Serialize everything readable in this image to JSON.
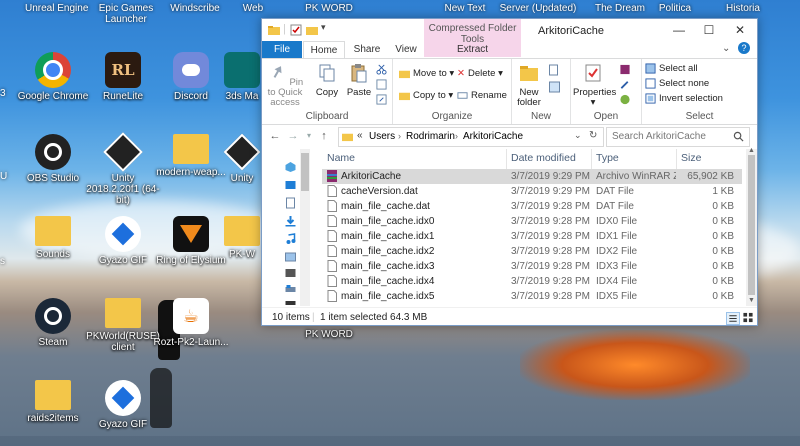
{
  "desktop": {
    "top_labels": [
      "Unreal Engine",
      "Epic Games Launcher",
      "Windscribe",
      "Web",
      "PK WORD",
      "New Text",
      "Server (Updated)",
      "The Dream",
      "Politica",
      "Historia"
    ],
    "icons": [
      {
        "label": "Google Chrome",
        "icon": "chrome-icon"
      },
      {
        "label": "RuneLite",
        "icon": "runelite-icon",
        "glyph": "RL"
      },
      {
        "label": "Discord",
        "icon": "discord-icon"
      },
      {
        "label": "3ds Ma",
        "icon": "3dsmax-icon"
      },
      {
        "label": "OBS Studio",
        "icon": "obs-icon"
      },
      {
        "label": "Unity 2018.2.20f1 (64-bit)",
        "icon": "unity-icon"
      },
      {
        "label": "modern-weap...",
        "icon": "folder-icon"
      },
      {
        "label": "Unity",
        "icon": "unity-icon"
      },
      {
        "label": "Sounds",
        "icon": "folder-icon"
      },
      {
        "label": "Gyazo GIF",
        "icon": "gyazo-icon"
      },
      {
        "label": "Ring of Elysium",
        "icon": "roe-icon"
      },
      {
        "label": "PK-W",
        "icon": "folder-icon"
      },
      {
        "label": "Steam",
        "icon": "steam-icon"
      },
      {
        "label": "PKWorld(RUSE) client",
        "icon": "folder-icon"
      },
      {
        "label": "Rozt-Pk2-Laun...",
        "icon": "java-icon"
      },
      {
        "label": "PK WORD",
        "icon": "text-icon"
      },
      {
        "label": "raids2items",
        "icon": "folder-icon"
      },
      {
        "label": "Gyazo GIF",
        "icon": "gyazo-icon"
      }
    ],
    "edge_labels": [
      "3",
      "U",
      "s"
    ]
  },
  "window": {
    "title": "ArkitoriCache",
    "context_tab_group": "Compressed Folder Tools",
    "controls": {
      "minimize": "—",
      "maximize": "☐",
      "close": "✕"
    },
    "tabs": [
      "File",
      "Home",
      "Share",
      "View",
      "Extract"
    ],
    "ribbon": {
      "clipboard": {
        "label": "Clipboard",
        "pin": "Pin to Quick access",
        "copy": "Copy",
        "paste": "Paste"
      },
      "organize": {
        "label": "Organize",
        "move_to": "Move to",
        "copy_to": "Copy to",
        "delete": "Delete",
        "rename": "Rename"
      },
      "new": {
        "label": "New",
        "new_folder": "New folder"
      },
      "open": {
        "label": "Open",
        "properties": "Properties"
      },
      "select": {
        "label": "Select",
        "select_all": "Select all",
        "select_none": "Select none",
        "invert": "Invert selection"
      }
    },
    "address": {
      "path": [
        "«",
        "Users",
        "Rodrimarin",
        "ArkitoriCache"
      ],
      "search_placeholder": "Search ArkitoriCache"
    },
    "columns": {
      "name": "Name",
      "date": "Date modified",
      "type": "Type",
      "size": "Size"
    },
    "files": [
      {
        "name": "ArkitoriCache",
        "date": "3/7/2019 9:29 PM",
        "type": "Archivo WinRAR Z...",
        "size": "65,902 KB",
        "selected": true,
        "icon": "winrar-icon"
      },
      {
        "name": "cacheVersion.dat",
        "date": "3/7/2019 9:29 PM",
        "type": "DAT File",
        "size": "1 KB",
        "selected": false,
        "icon": "file-icon"
      },
      {
        "name": "main_file_cache.dat",
        "date": "3/7/2019 9:28 PM",
        "type": "DAT File",
        "size": "0 KB",
        "selected": false,
        "icon": "file-icon"
      },
      {
        "name": "main_file_cache.idx0",
        "date": "3/7/2019 9:28 PM",
        "type": "IDX0 File",
        "size": "0 KB",
        "selected": false,
        "icon": "file-icon"
      },
      {
        "name": "main_file_cache.idx1",
        "date": "3/7/2019 9:28 PM",
        "type": "IDX1 File",
        "size": "0 KB",
        "selected": false,
        "icon": "file-icon"
      },
      {
        "name": "main_file_cache.idx2",
        "date": "3/7/2019 9:28 PM",
        "type": "IDX2 File",
        "size": "0 KB",
        "selected": false,
        "icon": "file-icon"
      },
      {
        "name": "main_file_cache.idx3",
        "date": "3/7/2019 9:28 PM",
        "type": "IDX3 File",
        "size": "0 KB",
        "selected": false,
        "icon": "file-icon"
      },
      {
        "name": "main_file_cache.idx4",
        "date": "3/7/2019 9:28 PM",
        "type": "IDX4 File",
        "size": "0 KB",
        "selected": false,
        "icon": "file-icon"
      },
      {
        "name": "main_file_cache.idx5",
        "date": "3/7/2019 9:28 PM",
        "type": "IDX5 File",
        "size": "0 KB",
        "selected": false,
        "icon": "file-icon"
      }
    ],
    "status": {
      "items": "10 items",
      "selected": "1 item selected  64.3 MB"
    }
  },
  "colors": {
    "accent": "#1979ca",
    "selected_row": "#d9d9d9",
    "context_tab": "#f6d5ea"
  }
}
